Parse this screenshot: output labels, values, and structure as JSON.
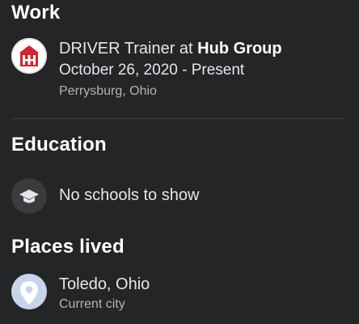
{
  "work": {
    "title": "Work",
    "job": {
      "role_prefix": "DRIVER Trainer at ",
      "company": "Hub Group",
      "dates": "October 26, 2020 - Present",
      "location": "Perrysburg, Ohio",
      "logo_icon": "hub-group-logo-icon"
    }
  },
  "education": {
    "title": "Education",
    "empty_text": "No schools to show",
    "icon": "graduation-cap-icon"
  },
  "places": {
    "title": "Places lived",
    "city": "Toledo, Ohio",
    "city_label": "Current city",
    "icon": "location-pin-icon"
  },
  "colors": {
    "background": "#242526",
    "text_primary": "#e4e6eb",
    "text_secondary": "#b0b3b8",
    "logo_red": "#d0262c",
    "pin_bg": "#c7d4ea"
  }
}
